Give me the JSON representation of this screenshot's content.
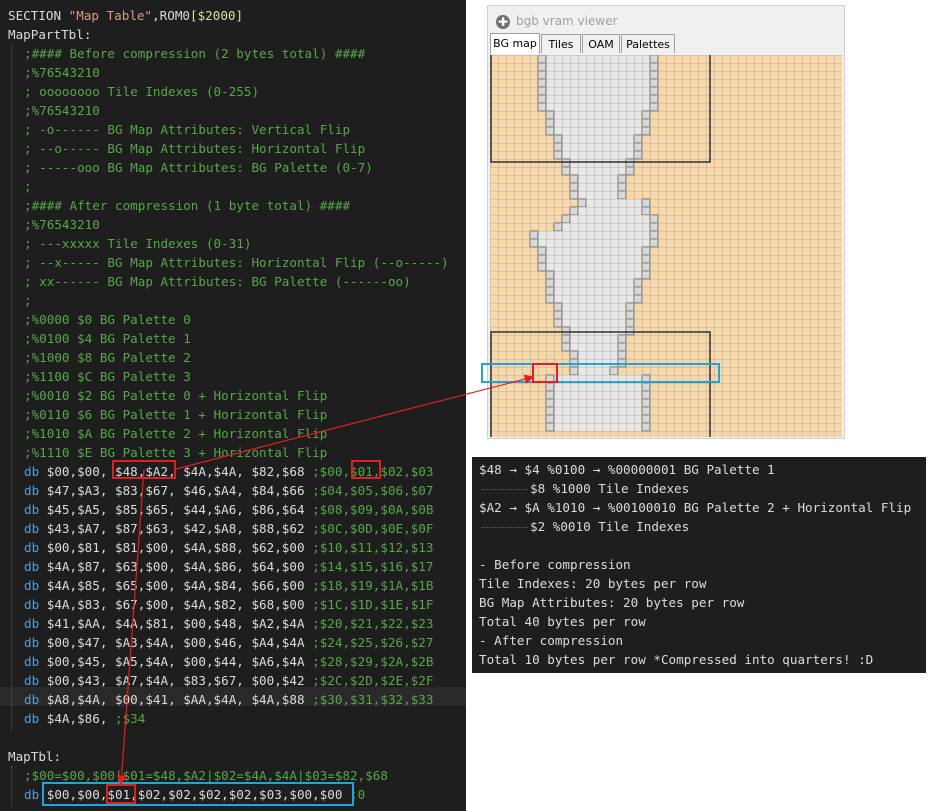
{
  "code_editor": {
    "lines": [
      {
        "type": "section",
        "kw": "SECTION ",
        "str": "\"Map Table\"",
        "rest": ",ROM0",
        "gold": "[$2000]"
      },
      {
        "type": "label",
        "text": "MapPartTbl:"
      },
      {
        "type": "comment",
        "text": ";#### Before compression (2 bytes total) ####"
      },
      {
        "type": "comment",
        "text": ";%76543210"
      },
      {
        "type": "comment",
        "text": "; oooooooo Tile Indexes (0-255)"
      },
      {
        "type": "comment",
        "text": ";%76543210"
      },
      {
        "type": "comment",
        "text": "; -o------ BG Map Attributes: Vertical Flip"
      },
      {
        "type": "comment",
        "text": "; --o----- BG Map Attributes: Horizontal Flip"
      },
      {
        "type": "comment",
        "text": "; -----ooo BG Map Attributes: BG Palette (0-7)"
      },
      {
        "type": "comment",
        "text": ";"
      },
      {
        "type": "comment",
        "text": ";#### After compression (1 byte total) ####"
      },
      {
        "type": "comment",
        "text": ";%76543210"
      },
      {
        "type": "comment",
        "text": "; ---xxxxx Tile Indexes (0-31)"
      },
      {
        "type": "comment",
        "text": "; --x----- BG Map Attributes: Horizontal Flip (--o-----)"
      },
      {
        "type": "comment",
        "text": "; xx------ BG Map Attributes: BG Palette (------oo)"
      },
      {
        "type": "comment",
        "text": ";"
      },
      {
        "type": "comment",
        "text": ";%0000 $0 BG Palette 0"
      },
      {
        "type": "comment",
        "text": ";%0100 $4 BG Palette 1"
      },
      {
        "type": "comment",
        "text": ";%1000 $8 BG Palette 2"
      },
      {
        "type": "comment",
        "text": ";%1100 $C BG Palette 3"
      },
      {
        "type": "comment",
        "text": ";%0010 $2 BG Palette 0 + Horizontal Flip"
      },
      {
        "type": "comment",
        "text": ";%0110 $6 BG Palette 1 + Horizontal Flip"
      },
      {
        "type": "comment",
        "text": ";%1010 $A BG Palette 2 + Horizontal Flip"
      },
      {
        "type": "comment",
        "text": ";%1110 $E BG Palette 3 + Horizontal Flip"
      },
      {
        "type": "db",
        "data": "$00,$00, $48,$A2, $4A,$4A, $82,$68 ",
        "comment": ";$00,$01,$02,$03"
      },
      {
        "type": "db",
        "data": "$47,$A3, $83,$67, $46,$A4, $84,$66 ",
        "comment": ";$04,$05,$06,$07"
      },
      {
        "type": "db",
        "data": "$45,$A5, $85,$65, $44,$A6, $86,$64 ",
        "comment": ";$08,$09,$0A,$0B"
      },
      {
        "type": "db",
        "data": "$43,$A7, $87,$63, $42,$A8, $88,$62 ",
        "comment": ";$0C,$0D,$0E,$0F"
      },
      {
        "type": "db",
        "data": "$00,$81, $81,$00, $4A,$88, $62,$00 ",
        "comment": ";$10,$11,$12,$13"
      },
      {
        "type": "db",
        "data": "$4A,$87, $63,$00, $4A,$86, $64,$00 ",
        "comment": ";$14,$15,$16,$17"
      },
      {
        "type": "db",
        "data": "$4A,$85, $65,$00, $4A,$84, $66,$00 ",
        "comment": ";$18,$19,$1A,$1B"
      },
      {
        "type": "db",
        "data": "$4A,$83, $67,$00, $4A,$82, $68,$00 ",
        "comment": ";$1C,$1D,$1E,$1F"
      },
      {
        "type": "db",
        "data": "$41,$AA, $4A,$81, $00,$48, $A2,$4A ",
        "comment": ";$20,$21,$22,$23"
      },
      {
        "type": "db",
        "data": "$00,$47, $A3,$4A, $00,$46, $A4,$4A ",
        "comment": ";$24,$25,$26,$27"
      },
      {
        "type": "db",
        "data": "$00,$45, $A5,$4A, $00,$44, $A6,$4A ",
        "comment": ";$28,$29,$2A,$2B"
      },
      {
        "type": "db",
        "data": "$00,$43, $A7,$4A, $83,$67, $00,$42 ",
        "comment": ";$2C,$2D,$2E,$2F"
      },
      {
        "type": "db",
        "data": "$A8,$4A, $00,$41, $AA,$4A, $4A,$88 ",
        "comment": ";$30,$31,$32,$33"
      },
      {
        "type": "db",
        "data": "$4A,$86, ",
        "comment": ";$34"
      },
      {
        "type": "blank",
        "text": ""
      },
      {
        "type": "label",
        "text": "MapTbl:"
      },
      {
        "type": "comment",
        "text": ";$00=$00,$00|$01=$48,$A2|$02=$4A,$4A|$03=$82,$68"
      },
      {
        "type": "db",
        "data": "$00,$00,$01,$02,$02,$02,$02,$03,$00,$00 ",
        "comment": ";0"
      }
    ]
  },
  "vram_viewer": {
    "title": "bgb vram viewer",
    "icon": "bgb-icon",
    "tabs": [
      "BG map",
      "Tiles",
      "OAM",
      "Palettes"
    ],
    "active_tab": "BG map",
    "colors": {
      "background": "#f8d8a8",
      "tile": "#e8e8e8",
      "grid": "#b8b0a8",
      "outline": "#303030"
    }
  },
  "notes_panel": {
    "lines": [
      "$48 → $4 %0100 → %00000001 BG Palette 1",
      "$8 %1000 Tile Indexes",
      "$A2 → $A %1010 → %00100010 BG Palette 2 + Horizontal Flip",
      "$2 %0010 Tile Indexes",
      "",
      "- Before compression",
      "Tile Indexes: 20 bytes per row",
      "BG Map Attributes: 20 bytes per row",
      "Total 40 bytes per row",
      "- After compression",
      "Total 10 bytes per row *Compressed into quarters! :D"
    ],
    "indented_lines": [
      1,
      3
    ]
  },
  "annotation_colors": {
    "red": "#e02020",
    "blue": "#1ea5e0"
  }
}
